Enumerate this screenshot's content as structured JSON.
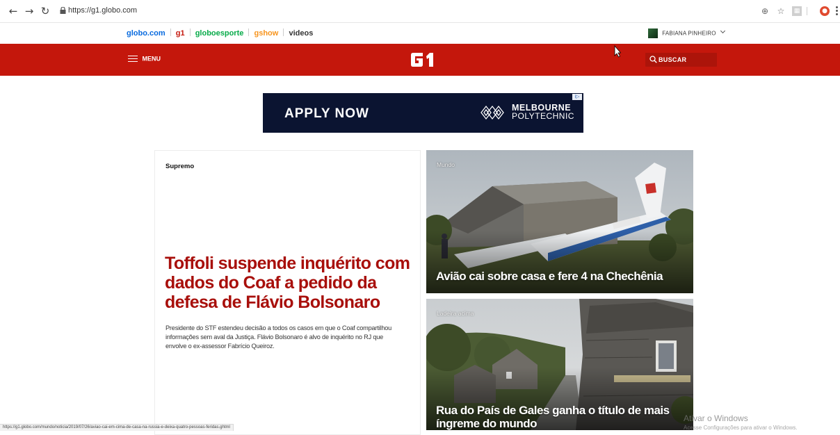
{
  "browser": {
    "url": "https://g1.globo.com",
    "status_url": "https://g1.globo.com/mundo/noticia/2019/07/26/aviao-cai-em-cima-de-casa-na-russia-e-deixa-quatro-pessoas-feridas.ghtml",
    "icons": [
      "back-arrow-icon",
      "forward-arrow-icon",
      "reload-icon",
      "lock-icon",
      "location-icon",
      "star-icon",
      "pdf-icon",
      "extension-icon",
      "menu-icon"
    ]
  },
  "globo_bar": {
    "links": [
      {
        "label": "globo.com",
        "color": "#0669de"
      },
      {
        "label": "g1",
        "color": "#c4170c"
      },
      {
        "label": "globoesporte",
        "color": "#06aa48"
      },
      {
        "label": "gshow",
        "color": "#f7941d"
      },
      {
        "label": "videos",
        "color": "#333333"
      }
    ],
    "user_name": "FABIANA PINHEIRO"
  },
  "header": {
    "menu_label": "MENU",
    "logo_text": "G1",
    "search_label": "BUSCAR",
    "accent_color": "#c4170c"
  },
  "ad": {
    "cta": "APPLY NOW",
    "brand_line1": "MELBOURNE",
    "brand_line2": "POLYTECHNIC",
    "choices": "i▷"
  },
  "main_story": {
    "section": "Supremo",
    "headline": "Toffoli suspende inquérito com dados do Coaf a pedido da defesa de Flávio Bolsonaro",
    "summary": "Presidente do STF estendeu decisão a todos os casos em que o Coaf compartilhou informações sem aval da Justiça. Flávio Bolsonaro é alvo de inquérito no RJ que envolve o ex-assessor Fabrício Queiroz."
  },
  "side_stories": [
    {
      "tag": "Mundo",
      "title": "Avião cai sobre casa e fere 4 na Chechênia"
    },
    {
      "tag": "Ladeira acima",
      "title": "Rua do País de Gales ganha o título de mais íngreme do mundo"
    }
  ],
  "watermark": {
    "title": "Ativar o Windows",
    "subtitle": "Acesse Configurações para ativar o Windows."
  }
}
